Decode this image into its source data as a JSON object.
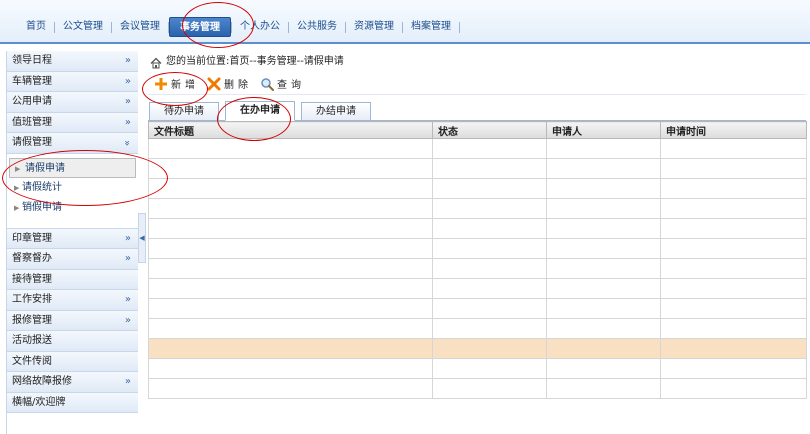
{
  "topnav": {
    "items": [
      "首页",
      "公文管理",
      "会议管理",
      "事务管理",
      "个人办公",
      "公共服务",
      "资源管理",
      "档案管理"
    ],
    "active_index": 3
  },
  "sidebar": {
    "items_top": [
      {
        "label": "领导日程",
        "arrow": "»"
      },
      {
        "label": "车辆管理",
        "arrow": "»"
      },
      {
        "label": "公用申请",
        "arrow": "»"
      },
      {
        "label": "值班管理",
        "arrow": "»"
      },
      {
        "label": "请假管理",
        "arrow": "«"
      }
    ],
    "sub_items": [
      "请假申请",
      "请假统计",
      "销假申请"
    ],
    "items_bottom": [
      {
        "label": "印章管理",
        "arrow": "»"
      },
      {
        "label": "督察督办",
        "arrow": "»"
      },
      {
        "label": "接待管理",
        "arrow": ""
      },
      {
        "label": "工作安排",
        "arrow": "»"
      },
      {
        "label": "报修管理",
        "arrow": "»"
      },
      {
        "label": "活动报送",
        "arrow": ""
      },
      {
        "label": "文件传阅",
        "arrow": ""
      },
      {
        "label": "网络故障报修",
        "arrow": "»"
      },
      {
        "label": "横幅/欢迎牌",
        "arrow": ""
      }
    ]
  },
  "breadcrumb": "您的当前位置:首页--事务管理--请假申请",
  "toolbar": {
    "add_label": "新增",
    "delete_label": "删除",
    "query_label": "查询"
  },
  "tabs": [
    "待办申请",
    "在办申请",
    "办结申请"
  ],
  "table": {
    "headers": [
      "文件标题",
      "状态",
      "申请人",
      "申请时间"
    ]
  },
  "colors": {
    "accent": "#2a63ac",
    "highlight_row": "#fae0c2",
    "annotation": "#d40000"
  }
}
